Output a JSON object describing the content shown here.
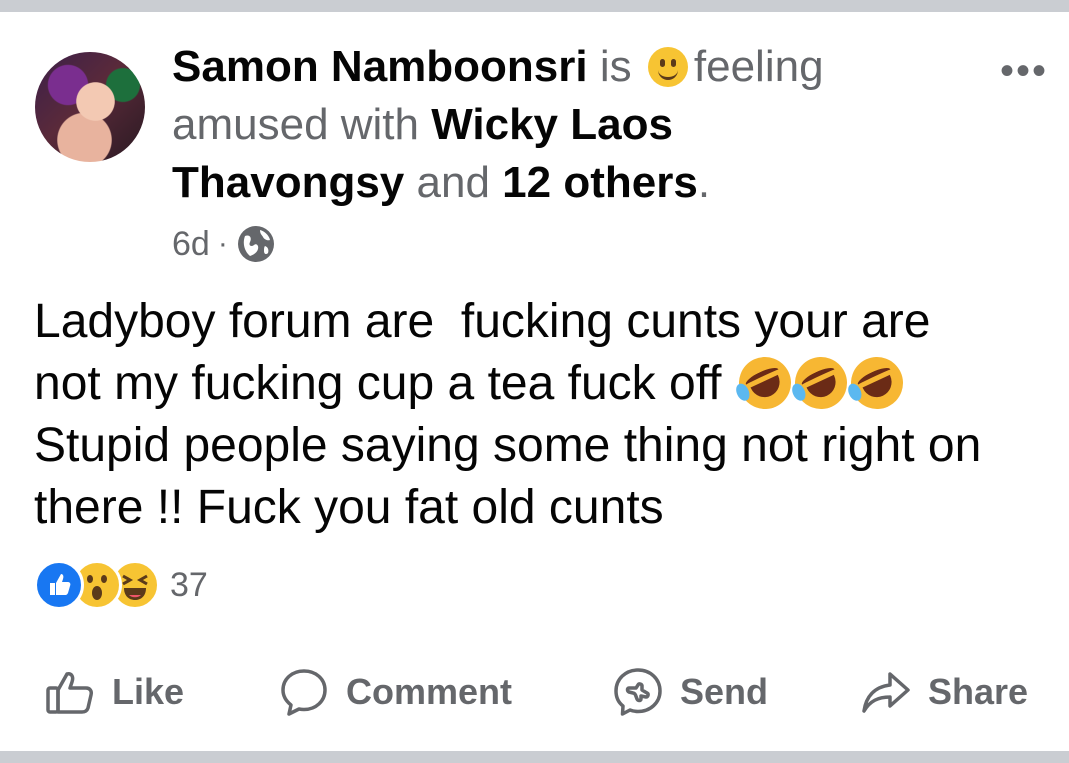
{
  "post": {
    "author": "Samon Namboonsri",
    "is_text": "is",
    "feeling_text": "feeling amused with",
    "tagged": "Wicky Laos Thavongsy",
    "and_text": "and",
    "others": "12 others",
    "period": ".",
    "time": "6d",
    "separator": "·",
    "privacy_icon": "globe-icon",
    "body_line1": "Ladyboy forum are  fucking cunts your are",
    "body_line2": "not my fucking cup a tea fuck off",
    "body_line3": "Stupid people saying some thing not right on",
    "body_line4": "there !! Fuck you fat old cunts",
    "reaction_count": "37",
    "reactions": [
      "like-icon",
      "wow-icon",
      "haha-icon"
    ]
  },
  "actions": {
    "like": "Like",
    "comment": "Comment",
    "send": "Send",
    "share": "Share"
  },
  "colors": {
    "text_primary": "#050505",
    "text_secondary": "#65676b",
    "like_blue": "#1877f2",
    "separator": "#cacdd2"
  }
}
